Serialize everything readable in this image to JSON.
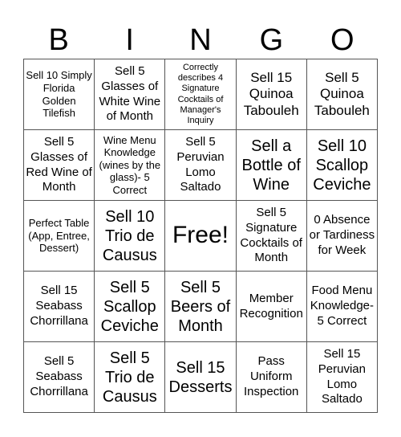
{
  "header": {
    "letters": [
      "B",
      "I",
      "N",
      "G",
      "O"
    ]
  },
  "cells": [
    [
      "Sell 10 Simply Florida Golden Tilefish",
      "Sell 5 Glasses of White Wine of Month",
      "Correctly describes 4 Signature Cocktails of Manager's Inquiry",
      "Sell 15 Quinoa Tabouleh",
      "Sell 5 Quinoa Tabouleh"
    ],
    [
      "Sell 5 Glasses of Red Wine of Month",
      "Wine Menu Knowledge (wines by the glass)- 5 Correct",
      "Sell 5 Peruvian Lomo Saltado",
      "Sell a Bottle of Wine",
      "Sell 10 Scallop Ceviche"
    ],
    [
      "Perfect Table (App, Entree, Dessert)",
      "Sell 10 Trio de Causus",
      "Free!",
      "Sell 5 Signature Cocktails of Month",
      "0 Absence or Tardiness for Week"
    ],
    [
      "Sell 15 Seabass Chorrillana",
      "Sell 5 Scallop Ceviche",
      "Sell 5 Beers of Month",
      "Member Recognition",
      "Food Menu Knowledge- 5 Correct"
    ],
    [
      "Sell 5 Seabass Chorrillana",
      "Sell 5 Trio de Causus",
      "Sell 15 Desserts",
      "Pass Uniform Inspection",
      "Sell 15 Peruvian Lomo Saltado"
    ]
  ]
}
